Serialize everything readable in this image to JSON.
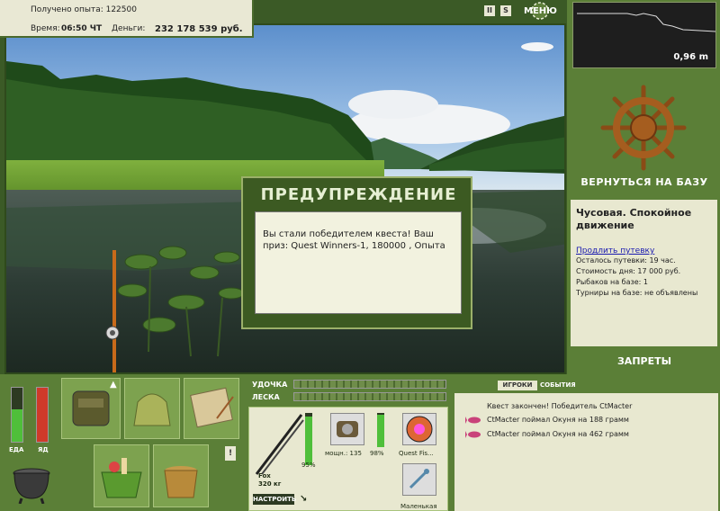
{
  "info": {
    "exp_label": "Получено опыта: 122500",
    "time_label": "Время:",
    "time_value": "06:50 ЧТ",
    "money_label": "Деньги:",
    "money_value": "232 178 539 руб."
  },
  "top_controls": {
    "pause_glyph": "II",
    "sound_glyph": "S",
    "menu_label": "МЕНЮ"
  },
  "depth": {
    "value": "0,96 m"
  },
  "right_panel": {
    "return_label": "ВЕРНУТЬСЯ НА БАЗУ",
    "location_name": "Чусовая. Спокойное движение",
    "extend_link": "Продлить путевку",
    "lines": [
      "Осталось путевки: 19 час.",
      "Стоимость дня: 17 000 руб.",
      "Рыбаков на базе: 1",
      "Турниры на базе: не объявлены"
    ],
    "bans_label": "ЗАПРЕТЫ"
  },
  "dialog": {
    "title": "ПРЕДУПРЕЖДЕНИЕ",
    "message": "Вы стали победителем квеста! Ваш приз: Quest Winners-1, 180000 , Опыта"
  },
  "status_bars": {
    "food_label": "ЕДА",
    "poison_label": "ЯД"
  },
  "tackle": {
    "rod_label": "УДОЧКА",
    "line_label": "ЛЕСКА",
    "rod_name": "Fox",
    "rod_weight": "320 кг",
    "rod_percent": "95%",
    "reel_name": "мощн.: 135",
    "reel_percent": "98%",
    "line_name": "Quest Fis...",
    "lure_name": "Маленькая",
    "setup_button": "НАСТРОИТЬ"
  },
  "events": {
    "tabs": [
      "ИГРОКИ",
      "СОБЫТИЯ"
    ],
    "items": [
      "Квест закончен! Победитель CtMacter",
      "CtMacter поймал Окуня на 188 грамм",
      "CtMacter поймал Окуня на 462 грамм"
    ]
  },
  "inventory": {
    "info_glyph": "!"
  }
}
